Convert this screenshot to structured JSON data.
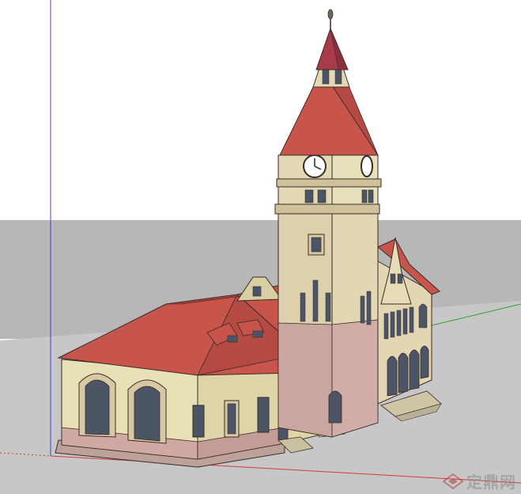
{
  "viewport": {
    "sky_color": "#ffffff",
    "ground_color": "#c9c9c9",
    "far_ground_color": "#b9b9b9"
  },
  "axes": {
    "x_axis_color": "#d43a3a",
    "y_axis_color": "#2fa32f",
    "z_axis_color": "#3f3fd8"
  },
  "model": {
    "wall_color": "#e6e0b8",
    "stone_color": "#d9ccab",
    "base_color": "#c9a6a0",
    "roof_color": "#c9574f",
    "spire_color": "#a83a4a",
    "window_color": "#4c5566"
  },
  "watermark": {
    "text": "定鼎网",
    "icon": "diamond-logo-icon"
  }
}
